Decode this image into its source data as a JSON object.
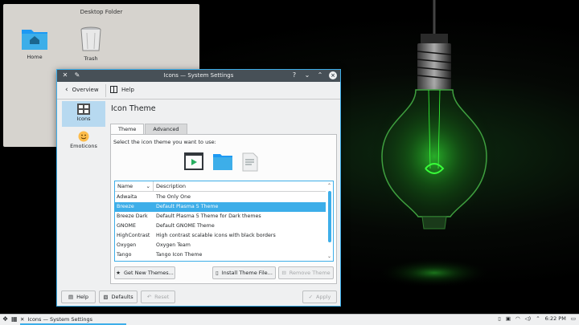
{
  "desktop": {
    "folder_title": "Desktop Folder",
    "icons": [
      {
        "label": "Home",
        "icon": "folder-home-icon"
      },
      {
        "label": "Trash",
        "icon": "trash-icon"
      }
    ]
  },
  "window": {
    "title": "Icons — System Settings",
    "toolbar": {
      "overview": "Overview",
      "help": "Help"
    },
    "sidebar": [
      {
        "label": "Icons",
        "icon": "icons-category-icon",
        "active": true
      },
      {
        "label": "Emoticons",
        "icon": "emoticon-icon",
        "active": false
      }
    ],
    "heading": "Icon Theme",
    "tabs": [
      {
        "label": "Theme",
        "active": true
      },
      {
        "label": "Advanced",
        "active": false
      }
    ],
    "prompt": "Select the icon theme you want to use:",
    "list": {
      "columns": [
        "Name",
        "Description"
      ],
      "rows": [
        {
          "name": "Adwaita",
          "description": "The Only One"
        },
        {
          "name": "Breeze",
          "description": "Default Plasma 5 Theme",
          "selected": true
        },
        {
          "name": "Breeze Dark",
          "description": "Default Plasma 5 Theme for Dark themes"
        },
        {
          "name": "GNOME",
          "description": "Default GNOME Theme"
        },
        {
          "name": "HighContrast",
          "description": "High contrast scalable icons with black borders"
        },
        {
          "name": "Oxygen",
          "description": "Oxygen Team"
        },
        {
          "name": "Tango",
          "description": "Tango Icon Theme"
        }
      ]
    },
    "buttons": {
      "get_new": "Get New Themes...",
      "install": "Install Theme File...",
      "remove": "Remove Theme",
      "help": "Help",
      "defaults": "Defaults",
      "reset": "Reset",
      "apply": "Apply"
    }
  },
  "taskbar": {
    "task_label": "Icons — System Settings",
    "clock": "6:22 PM"
  },
  "colors": {
    "accent": "#3daee9",
    "titlebar": "#475057",
    "window_bg": "#eff0f1",
    "bulb_glow": "#39ff3a"
  }
}
